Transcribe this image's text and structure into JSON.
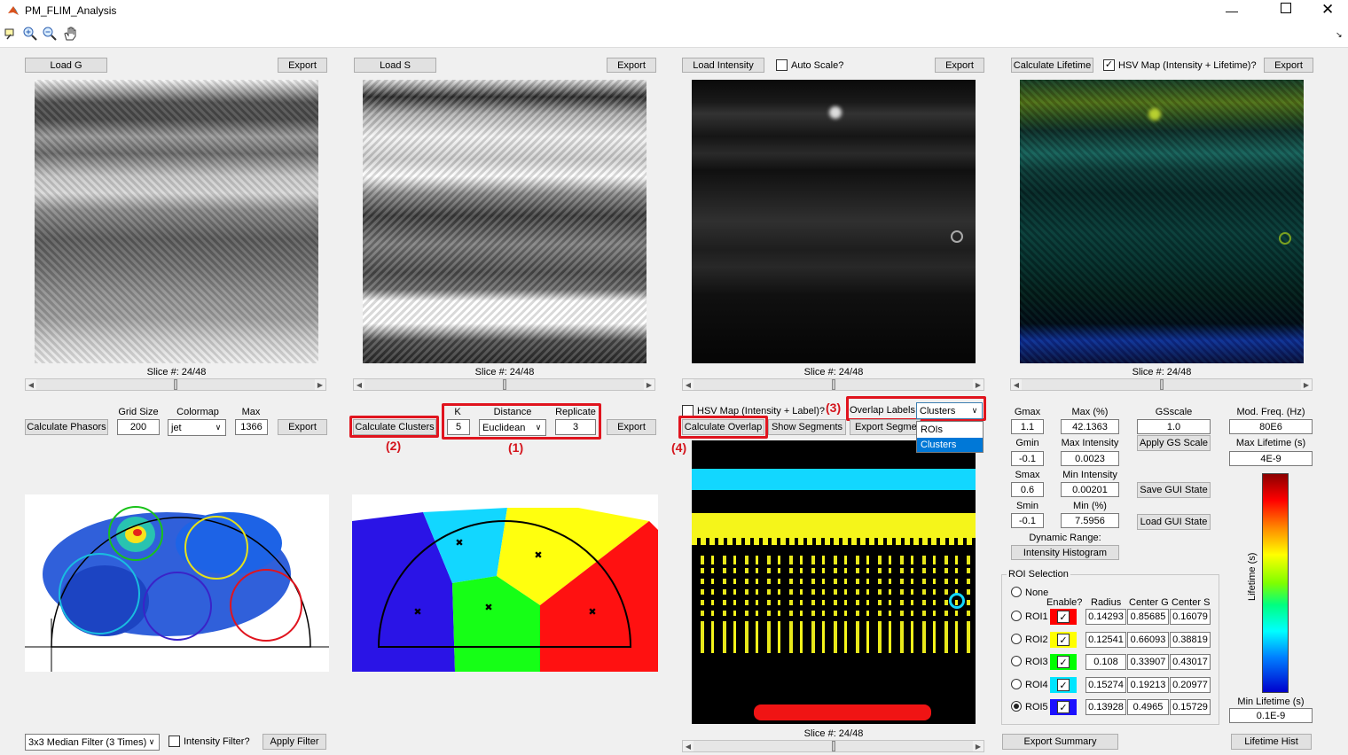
{
  "window": {
    "title": "PM_FLIM_Analysis",
    "icon": "matlab-icon",
    "controls": [
      "minimize-icon",
      "maximize-icon",
      "close-icon"
    ]
  },
  "toolbar": {
    "icons": [
      "data-cursor-icon",
      "zoom-in-icon",
      "zoom-out-icon",
      "pan-hand-icon"
    ]
  },
  "g_panel": {
    "load_label": "Load G",
    "export_label": "Export",
    "slice_label": "Slice #: 24/48"
  },
  "s_panel": {
    "load_label": "Load S",
    "export_label": "Export",
    "slice_label": "Slice #: 24/48"
  },
  "intensity_panel": {
    "load_label": "Load Intensity",
    "autoscale_label": "Auto Scale?",
    "autoscale_checked": false,
    "export_label": "Export",
    "slice_label": "Slice #: 24/48"
  },
  "lifetime_panel": {
    "calc_label": "Calculate Lifetime",
    "hsv_label": "HSV Map (Intensity + Lifetime)?",
    "hsv_checked": true,
    "export_label": "Export",
    "slice_label": "Slice #: 24/48"
  },
  "phasor": {
    "calc_label": "Calculate Phasors",
    "grid_size_label": "Grid Size",
    "grid_size_value": "200",
    "colormap_label": "Colormap",
    "colormap_value": "jet",
    "max_label": "Max",
    "max_value": "1366",
    "export_label": "Export"
  },
  "clusters": {
    "calc_label": "Calculate Clusters",
    "k_label": "K",
    "k_value": "5",
    "distance_label": "Distance",
    "distance_value": "Euclidean",
    "replicate_label": "Replicate",
    "replicate_value": "3",
    "export_label": "Export"
  },
  "overlap": {
    "hsv_label": "HSV Map (Intensity + Label)?",
    "hsv_checked": false,
    "overlap_labels_label": "Overlap Labels",
    "overlap_value": "Clusters",
    "options": [
      "ROIs",
      "Clusters"
    ],
    "calc_label": "Calculate Overlap",
    "show_segments_label": "Show Segments",
    "export_segments_label": "Export Segments",
    "slice_label": "Slice #: 24/48"
  },
  "annotations": [
    "(1)",
    "(2)",
    "(3)",
    "(4)"
  ],
  "settings": {
    "gmax_label": "Gmax",
    "gmax_value": "1.1",
    "gmin_label": "Gmin",
    "gmin_value": "-0.1",
    "smax_label": "Smax",
    "smax_value": "0.6",
    "smin_label": "Smin",
    "smin_value": "-0.1",
    "max_pct_label": "Max (%)",
    "max_pct_value": "42.1363",
    "max_int_label": "Max Intensity",
    "max_int_value": "0.0023",
    "min_int_label": "Min Intensity",
    "min_int_value": "0.00201",
    "min_pct_label": "Min (%)",
    "min_pct_value": "7.5956",
    "gsscale_label": "GSscale",
    "gsscale_value": "1.0",
    "apply_gs_label": "Apply GS Scale",
    "save_gui_label": "Save GUI State",
    "load_gui_label": "Load GUI State",
    "dynamic_range_label": "Dynamic Range:",
    "intensity_hist_label": "Intensity Histogram",
    "mod_freq_label": "Mod. Freq. (Hz)",
    "mod_freq_value": "80E6",
    "max_lifetime_label": "Max Lifetime (s)",
    "max_lifetime_value": "4E-9",
    "min_lifetime_label": "Min Lifetime (s)",
    "min_lifetime_value": "0.1E-9",
    "colorbar_label": "Lifetime (s)",
    "lifetime_hist_label": "Lifetime Hist"
  },
  "roi": {
    "title": "ROI Selection",
    "none_label": "None",
    "enable_label": "Enable?",
    "radius_label": "Radius",
    "center_g_label": "Center G",
    "center_s_label": "Center S",
    "rows": [
      {
        "label": "ROI1",
        "color": "#ff0000",
        "radius": "0.14293",
        "g": "0.85685",
        "s": "0.16079"
      },
      {
        "label": "ROI2",
        "color": "#ffff00",
        "radius": "0.12541",
        "g": "0.66093",
        "s": "0.38819"
      },
      {
        "label": "ROI3",
        "color": "#00ff00",
        "radius": "0.108",
        "g": "0.33907",
        "s": "0.43017"
      },
      {
        "label": "ROI4",
        "color": "#00e5ff",
        "radius": "0.15274",
        "g": "0.19213",
        "s": "0.20977"
      },
      {
        "label": "ROI5",
        "color": "#1c10ff",
        "radius": "0.13928",
        "g": "0.4965",
        "s": "0.15729"
      }
    ],
    "selected": "ROI5"
  },
  "bottom": {
    "filter_value": "3x3 Median Filter (3 Times)",
    "intensity_filter_label": "Intensity Filter?",
    "apply_filter_label": "Apply Filter",
    "export_summary_label": "Export Summary"
  }
}
